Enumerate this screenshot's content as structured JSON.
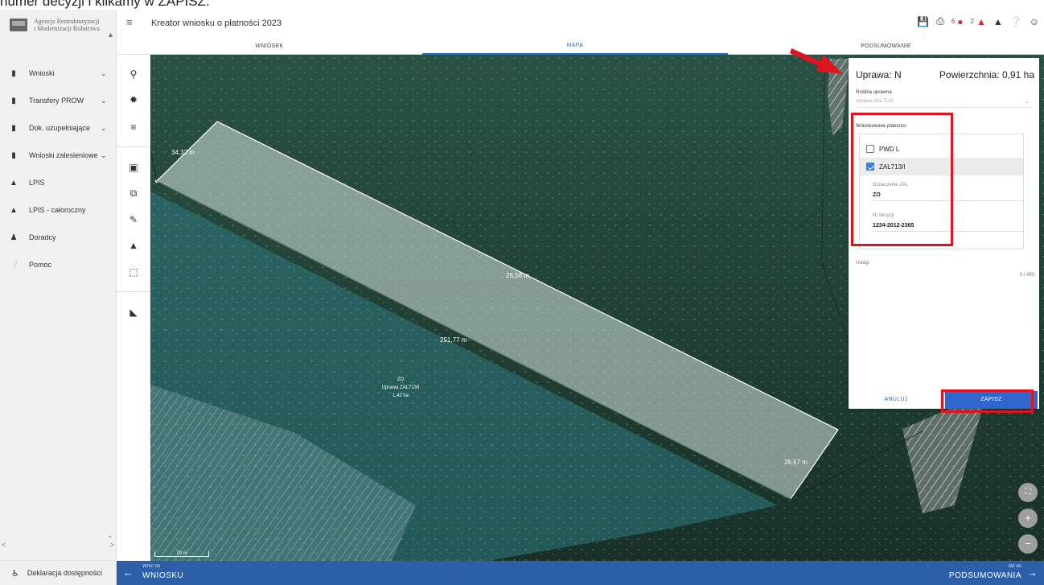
{
  "caption": "numer decyzji i klikamy w ZAPISZ.",
  "logo": {
    "line1": "Agencja Restrukturyzacji",
    "line2": "i Modernizacji Rolnictwa"
  },
  "sidebar": {
    "items": [
      {
        "label": "Wnioski",
        "icon": "document-icon",
        "caret": true
      },
      {
        "label": "Transfery PROW",
        "icon": "document-icon",
        "caret": true
      },
      {
        "label": "Dok. uzupełniające",
        "icon": "document-icon",
        "caret": true
      },
      {
        "label": "Wnioski zalesieniowe",
        "icon": "document-icon",
        "caret": true
      },
      {
        "label": "LPIS",
        "icon": "terrain-icon",
        "caret": false
      },
      {
        "label": "LPIS - całoroczny",
        "icon": "terrain-icon",
        "caret": false
      },
      {
        "label": "Doradcy",
        "icon": "person-icon",
        "caret": false
      },
      {
        "label": "Pomoc",
        "icon": "help-icon",
        "caret": false
      }
    ],
    "footer": "Deklaracja dostępności"
  },
  "header": {
    "title": "Kreator wniosku o płatności 2023",
    "badge_errors": "6",
    "badge_warnings": "2"
  },
  "tabs": [
    {
      "label": "WNIOSEK",
      "active": false
    },
    {
      "label": "MAPA",
      "active": true
    },
    {
      "label": "PODSUMOWANIE",
      "active": false
    }
  ],
  "map": {
    "labels": {
      "len1": "34,32 m",
      "len2": "26,58 m",
      "len3": "251,77 m",
      "len4": "26,57 m",
      "parcel_id": "ZO",
      "parcel_crop": "Uprawa ZAL713/I",
      "parcel_area": "1,42 ha"
    },
    "scale": "20 m",
    "colors": {
      "forest": "#1f3a33",
      "polygon": "#cfe0d4",
      "parcel": "#2f7a82"
    }
  },
  "panel": {
    "uprawa": "Uprawa: N",
    "powierzchnia": "Powierzchnia: 0,91 ha",
    "roslina_label": "Roślina uprawna",
    "roslina_value": "Uprawa ZAL713/I",
    "payments_label": "Wnioskowane płatności",
    "payments": [
      {
        "label": "PWD L",
        "checked": false
      },
      {
        "label": "ZAL713/I",
        "checked": true
      }
    ],
    "oznaczenie_label": "Oznaczenie ZAL",
    "oznaczenie_value": "ZO",
    "decyzja_label": "Nr decyzji",
    "decyzja_value": "1234-2012-2365",
    "uwagi_label": "Uwagi",
    "uwagi_count": "0 / 450",
    "cancel": "ANULUJ",
    "save": "ZAPISZ"
  },
  "bottom": {
    "back_small": "Wróć do",
    "back_big": "WNIOSKU",
    "next_small": "Idź do",
    "next_big": "PODSUMOWANIA"
  },
  "accent": "#2c5fa8",
  "highlight": "#e0141e"
}
